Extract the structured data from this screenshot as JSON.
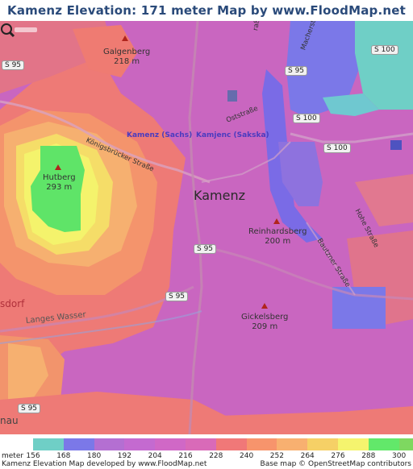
{
  "header": {
    "title": "Kamenz Elevation: 171 meter Map by www.FloodMap.net (beta)"
  },
  "map": {
    "town": "Kamenz",
    "places": {
      "galgenberg": {
        "name": "Galgenberg",
        "elevation": "218 m"
      },
      "hutberg": {
        "name": "Hutberg",
        "elevation": "293 m"
      },
      "reinhardsberg": {
        "name": "Reinhardsberg",
        "elevation": "200 m"
      },
      "gickelsberg": {
        "name": "Gickelsberg",
        "elevation": "209 m"
      }
    },
    "stations": {
      "kamenz_sachs": "Kamenz (Sachs)",
      "kamjenc": "Kamjenc (Sakska)"
    },
    "streets": {
      "koenigsbruecker": "Königsbrücker Straße",
      "oststrasse": "Oststraße",
      "macherstrasse": "Macherstr",
      "strasse_top": "raße",
      "bautzner": "Bautzner Straße",
      "hohe": "Hohe Straße",
      "langes_wasser": "Langes Wasser"
    },
    "edge_labels": {
      "left_dorf": "sdorf",
      "left_nau": "nau"
    },
    "road_shields": [
      "S 95",
      "S 95",
      "S 100",
      "S 100",
      "S 95",
      "S 95",
      "S 95",
      "S 100"
    ]
  },
  "legend": {
    "unit": "meter",
    "ticks": [
      "156",
      "168",
      "180",
      "192",
      "204",
      "216",
      "228",
      "240",
      "252",
      "264",
      "276",
      "288",
      "300"
    ],
    "colors": [
      "#6fcfc6",
      "#7b78e8",
      "#b46fd2",
      "#c46ad0",
      "#d068c6",
      "#d96ab8",
      "#f07878",
      "#f7946c",
      "#f8b070",
      "#f6d066",
      "#f5f46e",
      "#62e86a",
      "#7ed860"
    ],
    "credit_left": "Kamenz Elevation Map developed by www.FloodMap.net",
    "credit_right": "Base map © OpenStreetMap contributors"
  }
}
